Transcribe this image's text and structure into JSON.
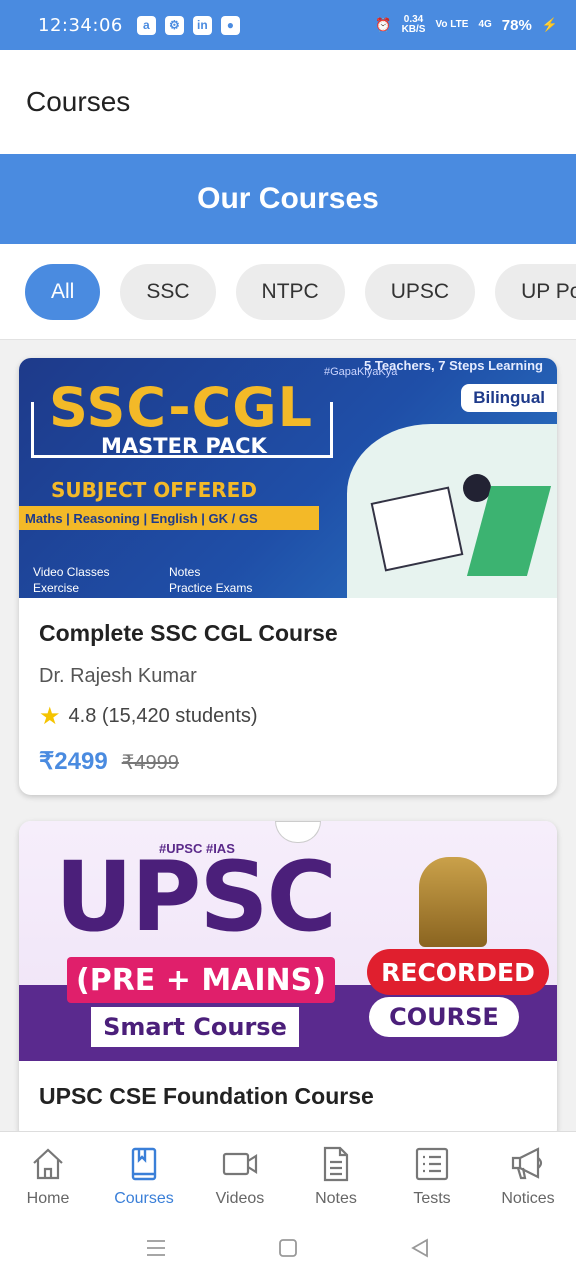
{
  "status_bar": {
    "time": "12:34:06",
    "notif_icons": [
      "a",
      "⚙",
      "in",
      "●"
    ],
    "net_speed_top": "0.34",
    "net_speed_bottom": "KB/S",
    "volte": "Vo LTE",
    "signal": "4G",
    "battery": "78%"
  },
  "app_bar": {
    "title": "Courses"
  },
  "banner": {
    "title": "Our Courses"
  },
  "filters": {
    "chips": [
      "All",
      "SSC",
      "NTPC",
      "UPSC",
      "UP Po"
    ],
    "active_index": 0
  },
  "courses": [
    {
      "title": "Complete SSC CGL Course",
      "instructor": "Dr. Rajesh Kumar",
      "rating_text": "4.8 (15,420 students)",
      "price": "₹2499",
      "original_price": "₹4999",
      "thumbnail": {
        "headline": "SSC-CGL",
        "subhead": "MASTER PACK",
        "label": "SUBJECT OFFERED",
        "subjects": "Maths | Reasoning | English | GK / GS",
        "features_left": [
          "Video Classes",
          "Exercise"
        ],
        "features_right": [
          "Notes",
          "Practice Exams"
        ],
        "badge": "Bilingual",
        "tagline": "5 Teachers, 7 Steps Learning",
        "hashtag": "#GapaKiyaKya"
      }
    },
    {
      "title": "UPSC CSE Foundation Course",
      "thumbnail": {
        "hashtag": "#UPSC #IAS",
        "headline": "UPSC",
        "ribbon": "(PRE + MAINS)",
        "subhead": "Smart Course",
        "badge_top": "RECORDED",
        "badge_bottom": "COURSE"
      }
    }
  ],
  "bottom_nav": {
    "items": [
      {
        "label": "Home",
        "icon": "home-icon"
      },
      {
        "label": "Courses",
        "icon": "book-icon"
      },
      {
        "label": "Videos",
        "icon": "video-camera-icon"
      },
      {
        "label": "Notes",
        "icon": "document-icon"
      },
      {
        "label": "Tests",
        "icon": "checklist-icon"
      },
      {
        "label": "Notices",
        "icon": "megaphone-icon"
      }
    ],
    "active_index": 1
  },
  "colors": {
    "primary": "#4a8be0",
    "price": "#4a8be0",
    "star": "#f5c400"
  }
}
